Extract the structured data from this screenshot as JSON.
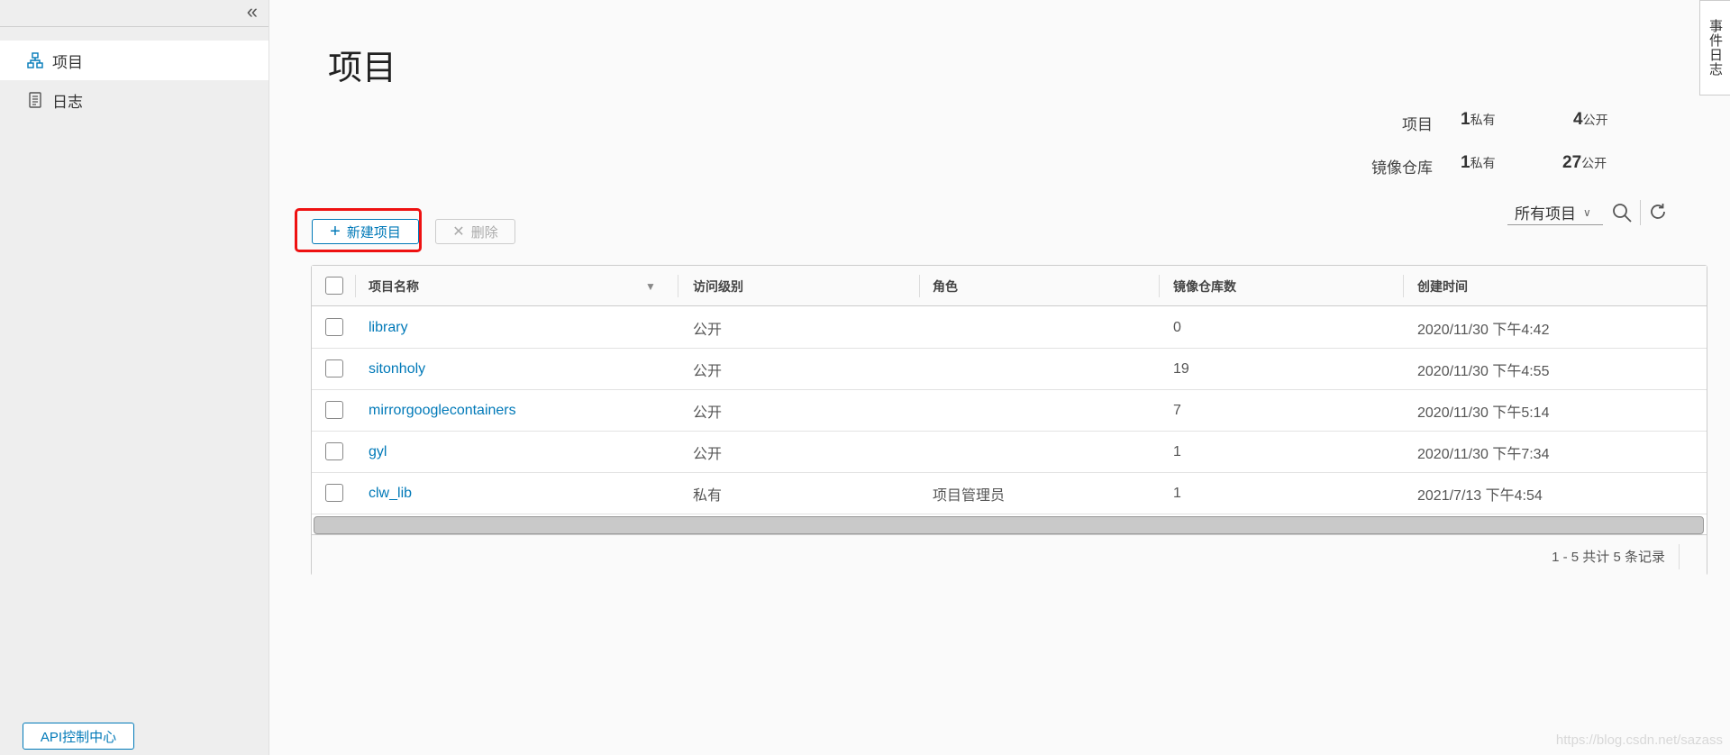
{
  "sidebar": {
    "collapse_icon": "chevron-double-left-icon",
    "items": [
      {
        "label": "项目",
        "icon": "project-icon",
        "active": true
      },
      {
        "label": "日志",
        "icon": "log-icon",
        "active": false
      }
    ],
    "api_button": "API控制中心"
  },
  "event_tab": "事件日志",
  "page": {
    "title": "项目"
  },
  "stats": {
    "projects_label": "项目",
    "repos_label": "镜像仓库",
    "projects_private": "1",
    "projects_public": "4",
    "repos_private": "1",
    "repos_public": "27",
    "private_unit": "私有",
    "public_unit": "公开"
  },
  "toolbar": {
    "new_button": "新建项目",
    "delete_button": "删除",
    "filter_value": "所有项目"
  },
  "table": {
    "headers": [
      "项目名称",
      "访问级别",
      "角色",
      "镜像仓库数",
      "创建时间"
    ],
    "rows": [
      {
        "name": "library",
        "access": "公开",
        "role": "",
        "repos": "0",
        "created": "2020/11/30 下午4:42"
      },
      {
        "name": "sitonholy",
        "access": "公开",
        "role": "",
        "repos": "19",
        "created": "2020/11/30 下午4:55"
      },
      {
        "name": "mirrorgooglecontainers",
        "access": "公开",
        "role": "",
        "repos": "7",
        "created": "2020/11/30 下午5:14"
      },
      {
        "name": "gyl",
        "access": "公开",
        "role": "",
        "repos": "1",
        "created": "2020/11/30 下午7:34"
      },
      {
        "name": "clw_lib",
        "access": "私有",
        "role": "项目管理员",
        "repos": "1",
        "created": "2021/7/13 下午4:54"
      }
    ],
    "pagination": "1 - 5 共计 5 条记录"
  },
  "watermark": "https://blog.csdn.net/sazass",
  "colors": {
    "accent": "#0079b8",
    "highlight": "#ee1111"
  }
}
